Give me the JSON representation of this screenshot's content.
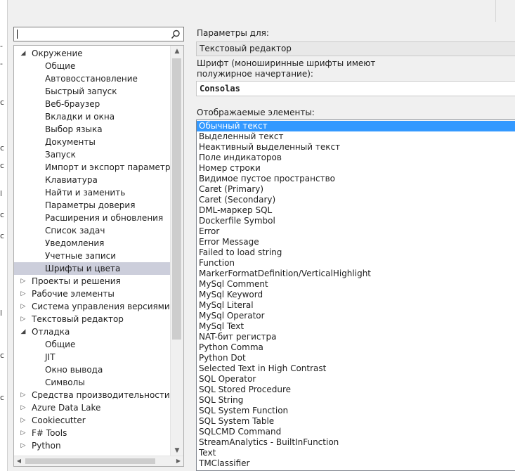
{
  "search": {
    "value": ""
  },
  "tree": [
    {
      "label": "Окружение",
      "level": 0,
      "arrow": "expanded"
    },
    {
      "label": "Общие",
      "level": 1
    },
    {
      "label": "Автовосстановление",
      "level": 1
    },
    {
      "label": "Быстрый запуск",
      "level": 1
    },
    {
      "label": "Веб-браузер",
      "level": 1
    },
    {
      "label": "Вкладки и окна",
      "level": 1
    },
    {
      "label": "Выбор языка",
      "level": 1
    },
    {
      "label": "Документы",
      "level": 1
    },
    {
      "label": "Запуск",
      "level": 1
    },
    {
      "label": "Импорт и экспорт параметров",
      "level": 1
    },
    {
      "label": "Клавиатура",
      "level": 1
    },
    {
      "label": "Найти и заменить",
      "level": 1
    },
    {
      "label": "Параметры доверия",
      "level": 1
    },
    {
      "label": "Расширения и обновления",
      "level": 1
    },
    {
      "label": "Список задач",
      "level": 1
    },
    {
      "label": "Уведомления",
      "level": 1
    },
    {
      "label": "Учетные записи",
      "level": 1
    },
    {
      "label": "Шрифты и цвета",
      "level": 1,
      "selected": true
    },
    {
      "label": "Проекты и решения",
      "level": 0,
      "arrow": "collapsed"
    },
    {
      "label": "Рабочие элементы",
      "level": 0,
      "arrow": "collapsed"
    },
    {
      "label": "Система управления версиями",
      "level": 0,
      "arrow": "collapsed"
    },
    {
      "label": "Текстовый редактор",
      "level": 0,
      "arrow": "collapsed"
    },
    {
      "label": "Отладка",
      "level": 0,
      "arrow": "expanded"
    },
    {
      "label": "Общие",
      "level": 1
    },
    {
      "label": "JIT",
      "level": 1
    },
    {
      "label": "Окно вывода",
      "level": 1
    },
    {
      "label": "Символы",
      "level": 1
    },
    {
      "label": "Средства производительности",
      "level": 0,
      "arrow": "collapsed"
    },
    {
      "label": "Azure Data Lake",
      "level": 0,
      "arrow": "collapsed"
    },
    {
      "label": "Cookiecutter",
      "level": 0,
      "arrow": "collapsed"
    },
    {
      "label": "F# Tools",
      "level": 0,
      "arrow": "collapsed"
    },
    {
      "label": "Python",
      "level": 0,
      "arrow": "collapsed"
    }
  ],
  "settings": {
    "for_label": "Параметры для:",
    "for_value": "Текстовый редактор",
    "font_label": "Шрифт (моноширинные шрифты имеют полужирное начертание):",
    "font_value": "Consolas",
    "items_label": "Отображаемые элементы:"
  },
  "display_items": [
    "Обычный текст",
    "Выделенный текст",
    "Неактивный выделенный текст",
    "Поле индикаторов",
    "Номер строки",
    "Видимое пустое пространство",
    "Caret (Primary)",
    "Caret (Secondary)",
    "DML-маркер SQL",
    "Dockerfile Symbol",
    "Error",
    "Error Message",
    "Failed to load string",
    "Function",
    "MarkerFormatDefinition/VerticalHighlight",
    "MySql Comment",
    "MySql Keyword",
    "MySql Literal",
    "MySql Operator",
    "MySql Text",
    "NAT-бит регистра",
    "Python Comma",
    "Python Dot",
    "Selected Text in High Contrast",
    "SQL Operator",
    "SQL Stored Procedure",
    "SQL String",
    "SQL System Function",
    "SQL System Table",
    "SQLCMD Command",
    "StreamAnalytics - BuiltInFunction",
    "Text",
    "TMClassifier"
  ],
  "selected_item": "Обычный текст",
  "colors": {
    "selection": "#3399ff",
    "tree_selection": "#cccedb"
  }
}
